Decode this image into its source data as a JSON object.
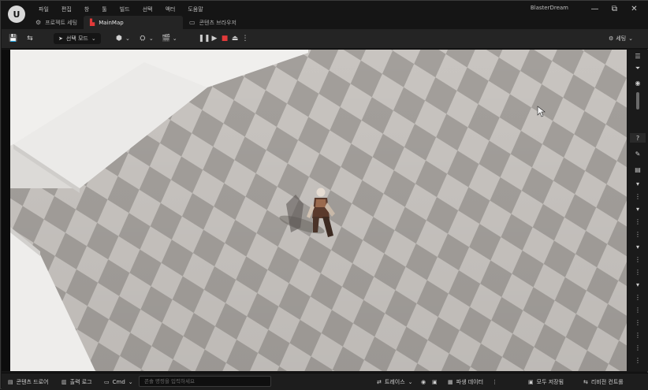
{
  "window": {
    "project_name": "BlasterDream",
    "logo": "U",
    "controls": {
      "minimize": "—",
      "maximize": "▢",
      "restore": "⧉",
      "close": "✕"
    }
  },
  "menu": [
    "파일",
    "편집",
    "창",
    "툴",
    "빌드",
    "선택",
    "액터",
    "도움말"
  ],
  "tabs": [
    {
      "label": "프로젝트 세팅",
      "icon": "gear-icon"
    },
    {
      "label": "MainMap",
      "icon": "level-icon"
    },
    {
      "label": "콘텐츠 브라우저",
      "icon": "folder-icon"
    }
  ],
  "toolbar": {
    "mode_label": "선택 모드",
    "settings_label": "세팅"
  },
  "statusbar": {
    "content_drawer": "콘텐츠 드로어",
    "output_log": "출력 로그",
    "cmd_label": "Cmd",
    "cmd_placeholder": "콘솔 명령을 입력하세요",
    "trace": "트레이스",
    "derived_data": "파생 데이터",
    "all_saved": "모두 저장됨",
    "revision_control": "리비전 컨트롤"
  },
  "colors": {
    "accent": "#e23a3a",
    "floor_light": "#c9c5c1",
    "floor_dark": "#a29e9a"
  }
}
